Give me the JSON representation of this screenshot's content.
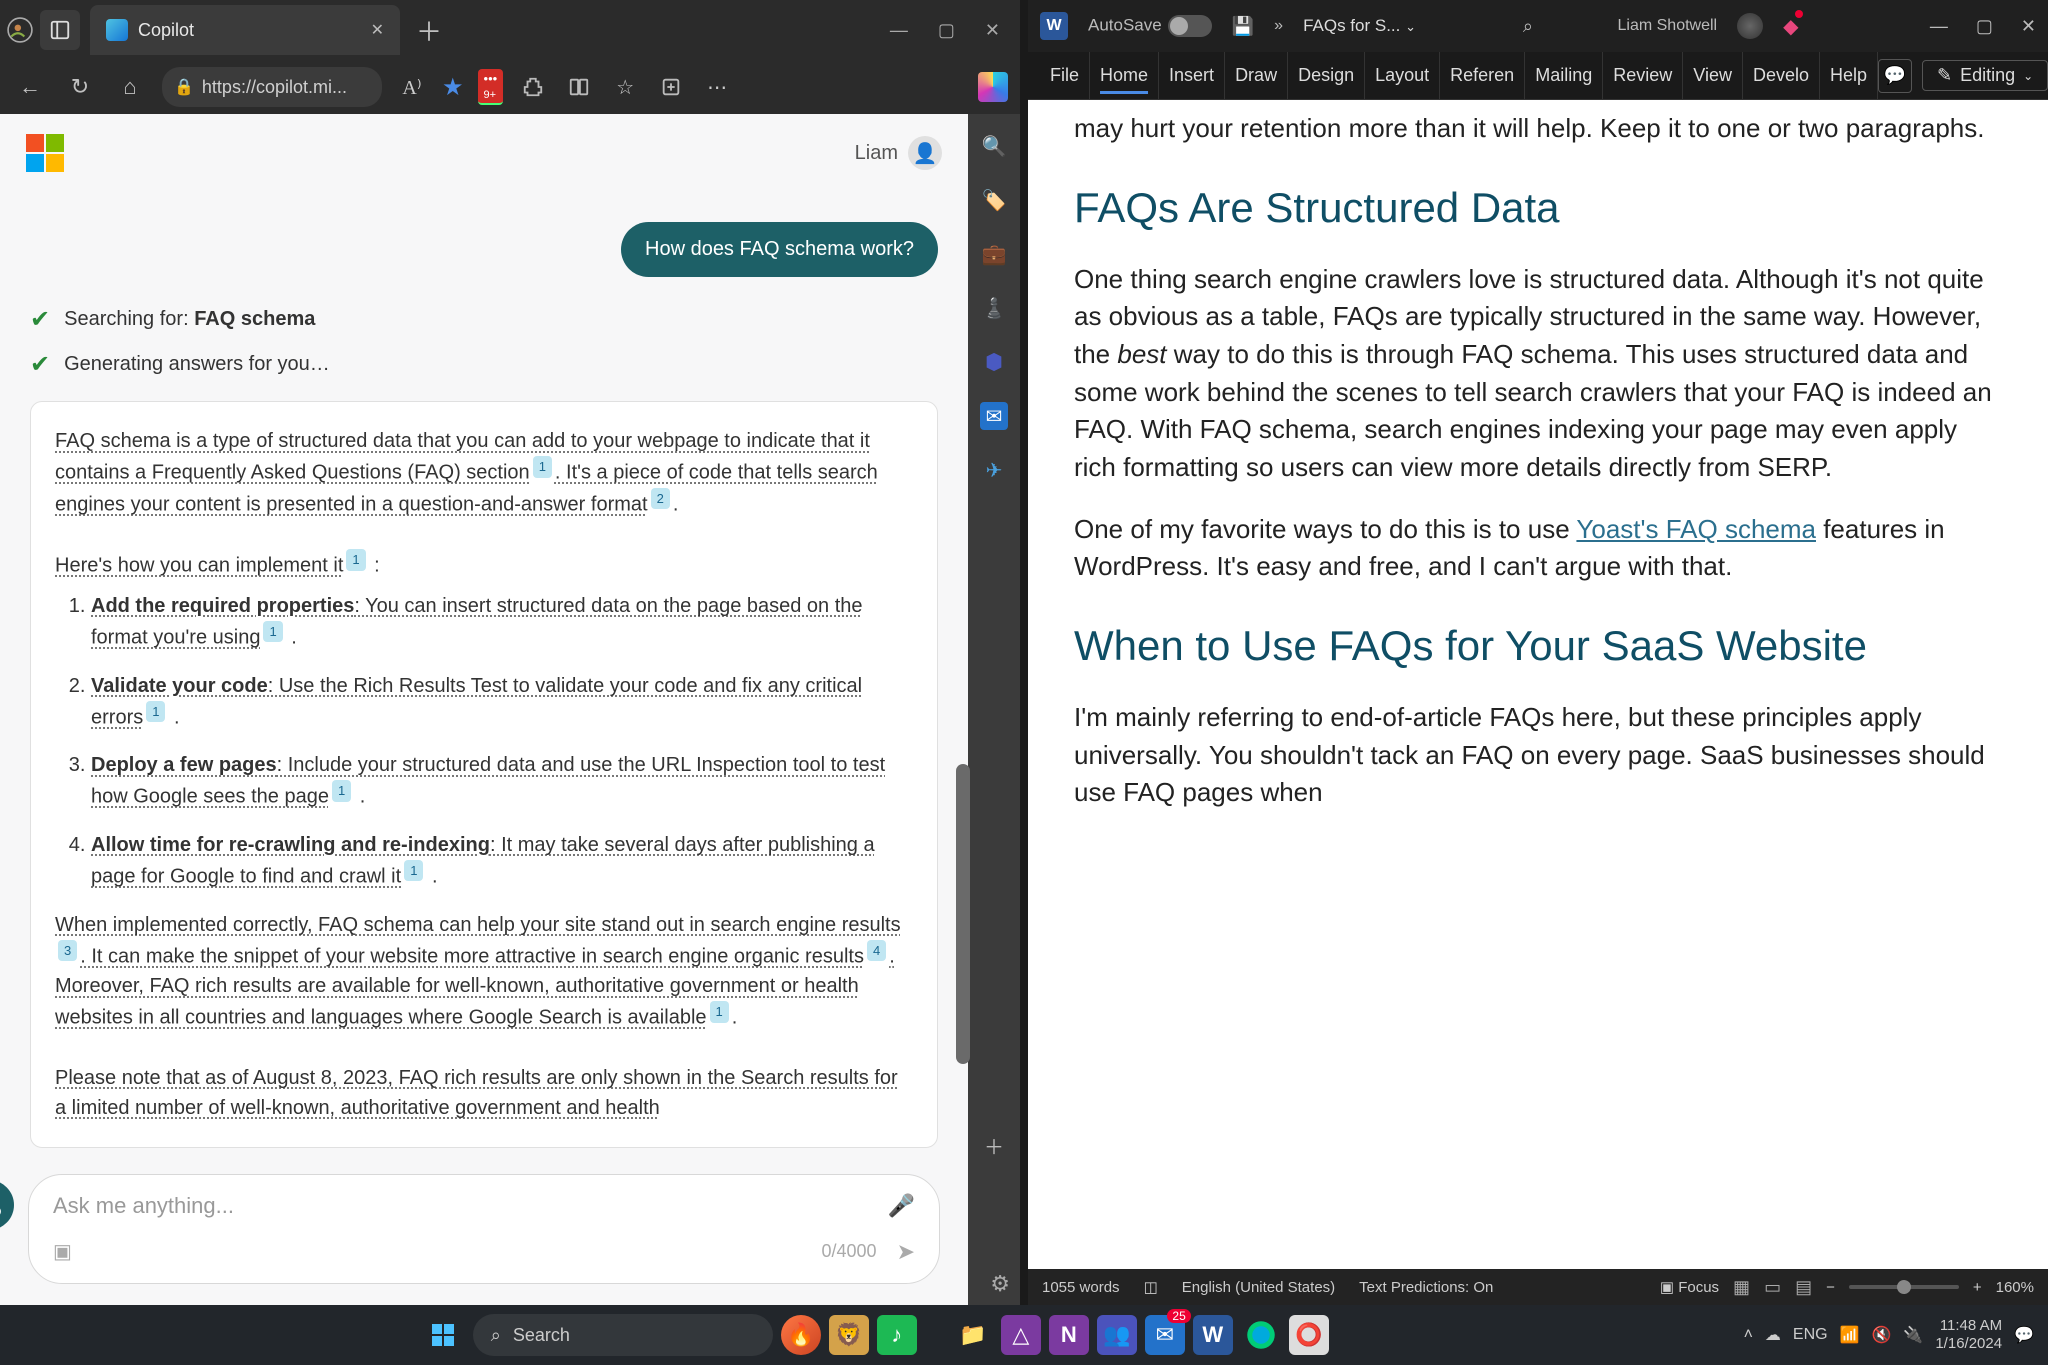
{
  "browser": {
    "tab_title": "Copilot",
    "url": "https://copilot.mi...",
    "user_name": "Liam",
    "user_prompt": "How does FAQ schema work?",
    "search_status_prefix": "Searching for: ",
    "search_term": "FAQ schema",
    "generating_status": "Generating answers for you…",
    "answer": {
      "p1_a": "FAQ schema is a type of structured data that you can add to your webpage to indicate that it contains a Frequently Asked Questions (FAQ) section",
      "p1_b": ". It's a piece of code that tells search engines your content is presented in a question-and-answer format",
      "p1_c": ".",
      "intro": "Here's how you can implement it",
      "colon": " :",
      "items": [
        {
          "bold": "Add the required properties",
          "rest": ": You can insert structured data on the page based on the format you're using",
          "cite": "1"
        },
        {
          "bold": "Validate your code",
          "rest": ": Use the Rich Results Test to validate your code and fix any critical errors",
          "cite": "1"
        },
        {
          "bold": "Deploy a few pages",
          "rest": ": Include your structured data and use the URL Inspection tool to test how Google sees the page",
          "cite": "1"
        },
        {
          "bold": "Allow time for re-crawling and re-indexing",
          "rest": ": It may take several days after publishing a page for Google to find and crawl it",
          "cite": "1"
        }
      ],
      "p3_a": "When implemented correctly, FAQ schema can help your site stand out in search engine results",
      "p3_b": ". It can make the snippet of your website more attractive in search engine organic results",
      "p3_c": ". Moreover, FAQ rich results are available for well-known, authoritative government or health websites in all countries and languages where Google Search is available",
      "p3_d": ".",
      "p4": "Please note that as of August 8, 2023, FAQ rich results are only shown in the Search results for a limited number of well-known, authoritative government and health"
    },
    "input_placeholder": "Ask me anything...",
    "char_count": "0/4000"
  },
  "word": {
    "autosave": "AutoSave",
    "doc_name": "FAQs for S...",
    "user_name": "Liam Shotwell",
    "ribbon_tabs": [
      "File",
      "Home",
      "Insert",
      "Draw",
      "Design",
      "Layout",
      "Referen",
      "Mailing",
      "Review",
      "View",
      "Develo",
      "Help"
    ],
    "editing_label": "Editing",
    "doc": {
      "intro_frag": "may hurt your retention more than it will help. Keep it to one or two paragraphs.",
      "intro_pre": "… ",
      "h2_1": "FAQs Are Structured Data",
      "p1_a": "One thing search engine crawlers love is structured data. Although it's not quite as obvious as a table, FAQs are typically structured in the same way. However, the ",
      "p1_best": "best",
      "p1_b": " way to do this is through FAQ schema. This uses structured data and some work behind the scenes to tell search crawlers that your FAQ is indeed an FAQ. With FAQ schema, search engines indexing your page may even apply rich formatting so users can view more details directly from SERP.",
      "p2_a": "One of my favorite ways to do this is to use ",
      "p2_link": "Yoast's FAQ schema",
      "p2_b": " features in WordPress. It's easy and free, and I can't argue with that.",
      "h2_2": "When to Use FAQs for Your SaaS Website",
      "p3": "I'm mainly referring to end-of-article FAQs here, but these principles apply universally. You shouldn't tack an FAQ on every page. SaaS businesses should use FAQ pages when"
    },
    "statusbar": {
      "words": "1055 words",
      "lang": "English (United States)",
      "predictions": "Text Predictions: On",
      "focus": "Focus",
      "zoom": "160%"
    }
  },
  "taskbar": {
    "search_placeholder": "Search",
    "calendar_badge": "25",
    "time": "11:48 AM",
    "date": "1/16/2024"
  }
}
